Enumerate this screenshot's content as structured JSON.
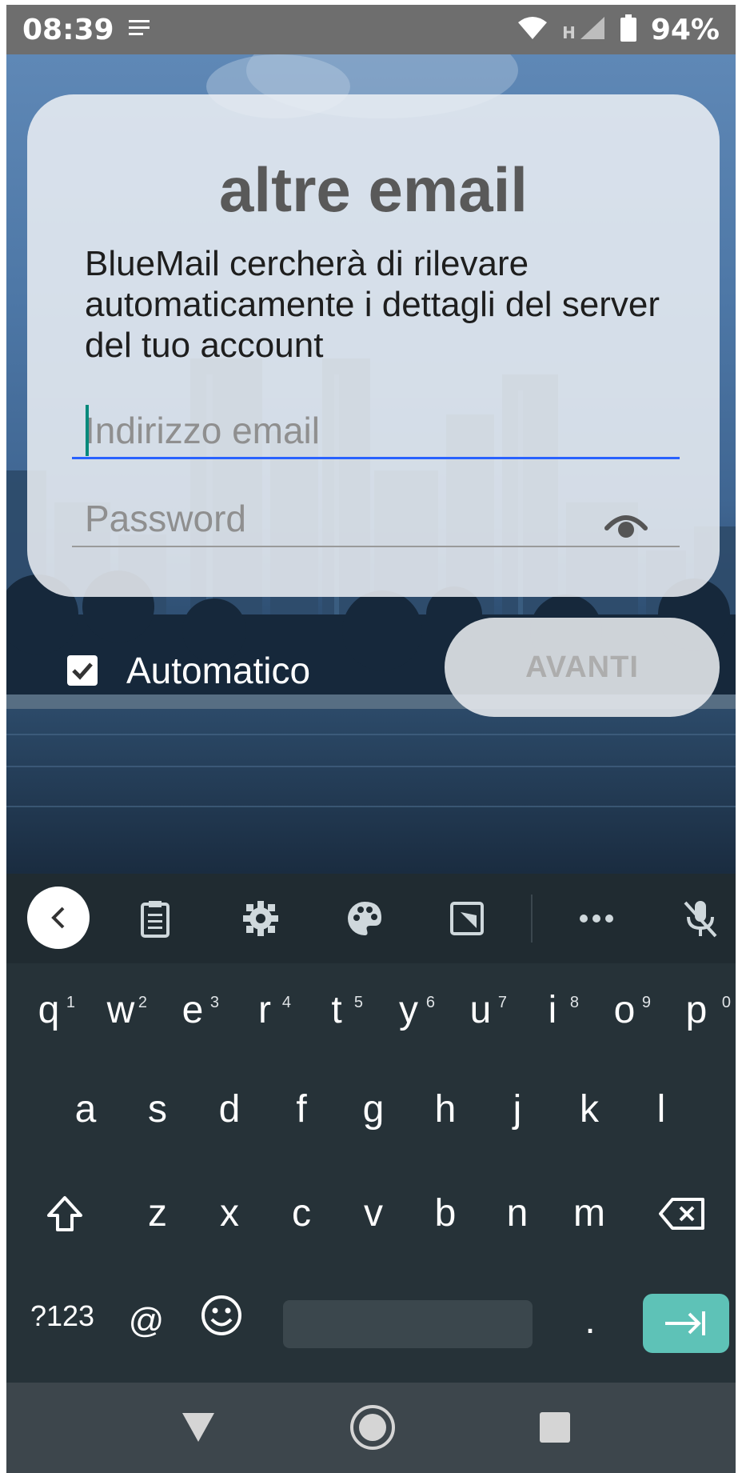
{
  "status_bar": {
    "time": "08:39",
    "network_hint": "H",
    "battery": "94%"
  },
  "card": {
    "title": "altre email",
    "description": "BlueMail cercherà di rilevare automaticamente i dettagli del server del tuo account",
    "email_placeholder": "Indirizzo email",
    "email_value": "",
    "password_placeholder": "Password",
    "password_value": ""
  },
  "options": {
    "automatic_label": "Automatico",
    "automatic_checked": true,
    "next_label": "AVANTI"
  },
  "keyboard": {
    "row1": [
      {
        "key": "q",
        "hint": "1"
      },
      {
        "key": "w",
        "hint": "2"
      },
      {
        "key": "e",
        "hint": "3"
      },
      {
        "key": "r",
        "hint": "4"
      },
      {
        "key": "t",
        "hint": "5"
      },
      {
        "key": "y",
        "hint": "6"
      },
      {
        "key": "u",
        "hint": "7"
      },
      {
        "key": "i",
        "hint": "8"
      },
      {
        "key": "o",
        "hint": "9"
      },
      {
        "key": "p",
        "hint": "0"
      }
    ],
    "row2": [
      "a",
      "s",
      "d",
      "f",
      "g",
      "h",
      "j",
      "k",
      "l"
    ],
    "row3": [
      "z",
      "x",
      "c",
      "v",
      "b",
      "n",
      "m"
    ],
    "symbols_label": "?123",
    "at_label": "@",
    "period_label": ".",
    "toolbar_icons": [
      "back-icon",
      "clipboard-icon",
      "settings-icon",
      "palette-icon",
      "floating-keyboard-icon",
      "more-icon",
      "mic-off-icon"
    ]
  },
  "colors": {
    "accent_blue": "#2962ff",
    "caret_teal": "#00897b",
    "enter_key": "#5ec2b7",
    "keyboard_bg": "#263238"
  }
}
